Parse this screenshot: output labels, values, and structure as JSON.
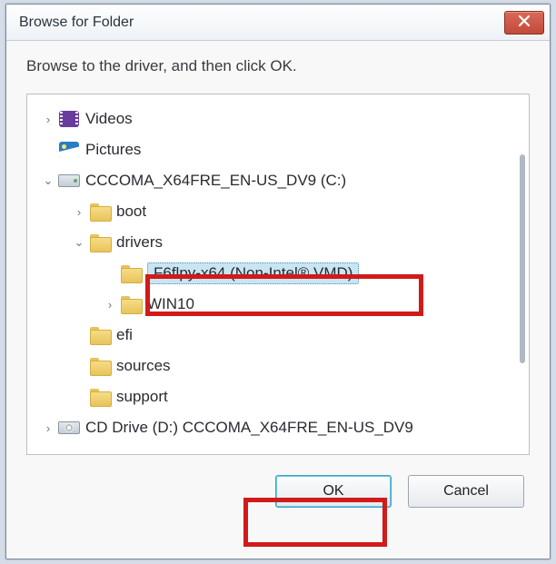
{
  "dialog": {
    "title": "Browse for Folder"
  },
  "instruction": "Browse to the driver, and then click OK.",
  "tree": {
    "items": [
      {
        "depth": 0,
        "expander": "closed",
        "icon": "videos-icon",
        "label": "Videos"
      },
      {
        "depth": 0,
        "expander": "none",
        "icon": "pictures-icon",
        "label": "Pictures"
      },
      {
        "depth": 0,
        "expander": "open",
        "icon": "drive-hdd",
        "label": "CCCOMA_X64FRE_EN-US_DV9 (C:)"
      },
      {
        "depth": 1,
        "expander": "closed",
        "icon": "folder",
        "label": "boot"
      },
      {
        "depth": 1,
        "expander": "open",
        "icon": "folder",
        "label": "drivers"
      },
      {
        "depth": 2,
        "expander": "none",
        "icon": "folder",
        "label": "F6flpy-x64 (Non-Intel® VMD)",
        "selected": true
      },
      {
        "depth": 2,
        "expander": "closed",
        "icon": "folder",
        "label": "WIN10"
      },
      {
        "depth": 1,
        "expander": "none",
        "icon": "folder",
        "label": "efi"
      },
      {
        "depth": 1,
        "expander": "none",
        "icon": "folder",
        "label": "sources"
      },
      {
        "depth": 1,
        "expander": "none",
        "icon": "folder",
        "label": "support"
      },
      {
        "depth": 0,
        "expander": "closed",
        "icon": "drive-cd",
        "label": "CD Drive (D:) CCCOMA_X64FRE_EN-US_DV9"
      }
    ]
  },
  "buttons": {
    "ok": "OK",
    "cancel": "Cancel"
  },
  "layout": {
    "indentPx": 34
  },
  "annotations": {
    "highlight_selected_row": true,
    "highlight_ok_button": true
  }
}
